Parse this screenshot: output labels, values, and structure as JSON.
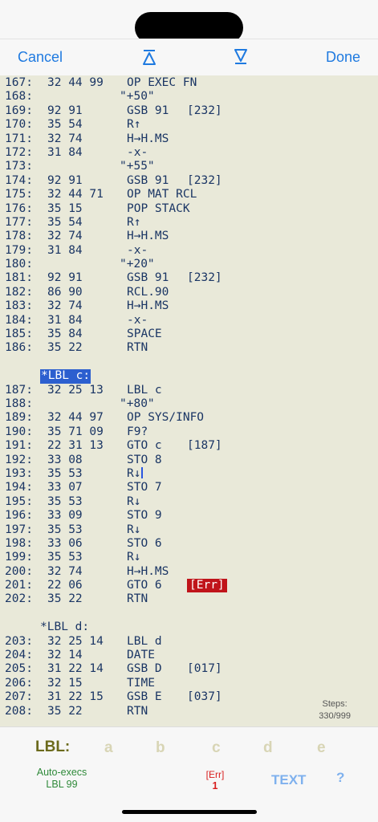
{
  "navbar": {
    "cancel_label": "Cancel",
    "done_label": "Done",
    "up_icon": "jump-to-top-arrow",
    "down_icon": "jump-to-bottom-arrow"
  },
  "listing": [
    {
      "type": "step",
      "num": "167:",
      "code": "32 44 99",
      "op": "OP EXEC FN"
    },
    {
      "type": "string",
      "num": "168:",
      "text": "\"+50\""
    },
    {
      "type": "step",
      "num": "169:",
      "code": "92 91",
      "op": "GSB 91",
      "ann": "[232]"
    },
    {
      "type": "step",
      "num": "170:",
      "code": "35 54",
      "op": "R↑"
    },
    {
      "type": "step",
      "num": "171:",
      "code": "32 74",
      "op": "H→H.MS"
    },
    {
      "type": "step",
      "num": "172:",
      "code": "31 84",
      "op": "-x-"
    },
    {
      "type": "string",
      "num": "173:",
      "text": "\"+55\""
    },
    {
      "type": "step",
      "num": "174:",
      "code": "92 91",
      "op": "GSB 91",
      "ann": "[232]"
    },
    {
      "type": "step",
      "num": "175:",
      "code": "32 44 71",
      "op": "OP MAT RCL"
    },
    {
      "type": "step",
      "num": "176:",
      "code": "35 15",
      "op": "POP STACK"
    },
    {
      "type": "step",
      "num": "177:",
      "code": "35 54",
      "op": "R↑"
    },
    {
      "type": "step",
      "num": "178:",
      "code": "32 74",
      "op": "H→H.MS"
    },
    {
      "type": "step",
      "num": "179:",
      "code": "31 84",
      "op": "-x-"
    },
    {
      "type": "string",
      "num": "180:",
      "text": "\"+20\""
    },
    {
      "type": "step",
      "num": "181:",
      "code": "92 91",
      "op": "GSB 91",
      "ann": "[232]"
    },
    {
      "type": "step",
      "num": "182:",
      "code": "86 90",
      "op": "RCL.90"
    },
    {
      "type": "step",
      "num": "183:",
      "code": "32 74",
      "op": "H→H.MS"
    },
    {
      "type": "step",
      "num": "184:",
      "code": "31 84",
      "op": "-x-"
    },
    {
      "type": "step",
      "num": "185:",
      "code": "35 84",
      "op": "SPACE"
    },
    {
      "type": "step",
      "num": "186:",
      "code": "35 22",
      "op": "RTN"
    },
    {
      "type": "blank"
    },
    {
      "type": "label",
      "text": "*LBL c:",
      "highlight": true
    },
    {
      "type": "step",
      "num": "187:",
      "code": "32 25 13",
      "op": "LBL c"
    },
    {
      "type": "string",
      "num": "188:",
      "text": "\"+80\""
    },
    {
      "type": "step",
      "num": "189:",
      "code": "32 44 97",
      "op": "OP SYS/INFO"
    },
    {
      "type": "step",
      "num": "190:",
      "code": "35 71 09",
      "op": "F9?"
    },
    {
      "type": "step",
      "num": "191:",
      "code": "22 31 13",
      "op": "GTO c",
      "ann": "[187]"
    },
    {
      "type": "step",
      "num": "192:",
      "code": "33 08",
      "op": "STO 8"
    },
    {
      "type": "step",
      "num": "193:",
      "code": "35 53",
      "op": "R↓",
      "cursor": true
    },
    {
      "type": "step",
      "num": "194:",
      "code": "33 07",
      "op": "STO 7"
    },
    {
      "type": "step",
      "num": "195:",
      "code": "35 53",
      "op": "R↓"
    },
    {
      "type": "step",
      "num": "196:",
      "code": "33 09",
      "op": "STO 9"
    },
    {
      "type": "step",
      "num": "197:",
      "code": "35 53",
      "op": "R↓"
    },
    {
      "type": "step",
      "num": "198:",
      "code": "33 06",
      "op": "STO 6"
    },
    {
      "type": "step",
      "num": "199:",
      "code": "35 53",
      "op": "R↓"
    },
    {
      "type": "step",
      "num": "200:",
      "code": "32 74",
      "op": "H→H.MS"
    },
    {
      "type": "step",
      "num": "201:",
      "code": "22 06",
      "op": "GTO 6",
      "ann": "[Err]",
      "err": true
    },
    {
      "type": "step",
      "num": "202:",
      "code": "35 22",
      "op": "RTN"
    },
    {
      "type": "blank"
    },
    {
      "type": "label",
      "text": "*LBL d:",
      "highlight": false
    },
    {
      "type": "step",
      "num": "203:",
      "code": "32 25 14",
      "op": "LBL d"
    },
    {
      "type": "step",
      "num": "204:",
      "code": "32 14",
      "op": "DATE"
    },
    {
      "type": "step",
      "num": "205:",
      "code": "31 22 14",
      "op": "GSB D",
      "ann": "[017]"
    },
    {
      "type": "step",
      "num": "206:",
      "code": "32 15",
      "op": "TIME"
    },
    {
      "type": "step",
      "num": "207:",
      "code": "31 22 15",
      "op": "GSB E",
      "ann": "[037]"
    },
    {
      "type": "step",
      "num": "208:",
      "code": "35 22",
      "op": "RTN"
    }
  ],
  "steps": {
    "label": "Steps:",
    "value": "330/999"
  },
  "toolbar": {
    "lbl_title": "LBL:",
    "lbl_keys": [
      "a",
      "b",
      "c",
      "d",
      "e"
    ],
    "autoexec_line1": "Auto-execs",
    "autoexec_line2": "LBL 99",
    "err_label": "[Err]",
    "err_count": "1",
    "text_label": "TEXT",
    "help_label": "?"
  },
  "colors": {
    "listing_bg": "#e9e9d9",
    "listing_text": "#1a3564",
    "accent": "#1f7ae0",
    "error": "#c0141a",
    "label_highlight": "#2c5fcf",
    "autoexec_green": "#2f8a3a",
    "lbl_title": "#6b6a1c"
  }
}
